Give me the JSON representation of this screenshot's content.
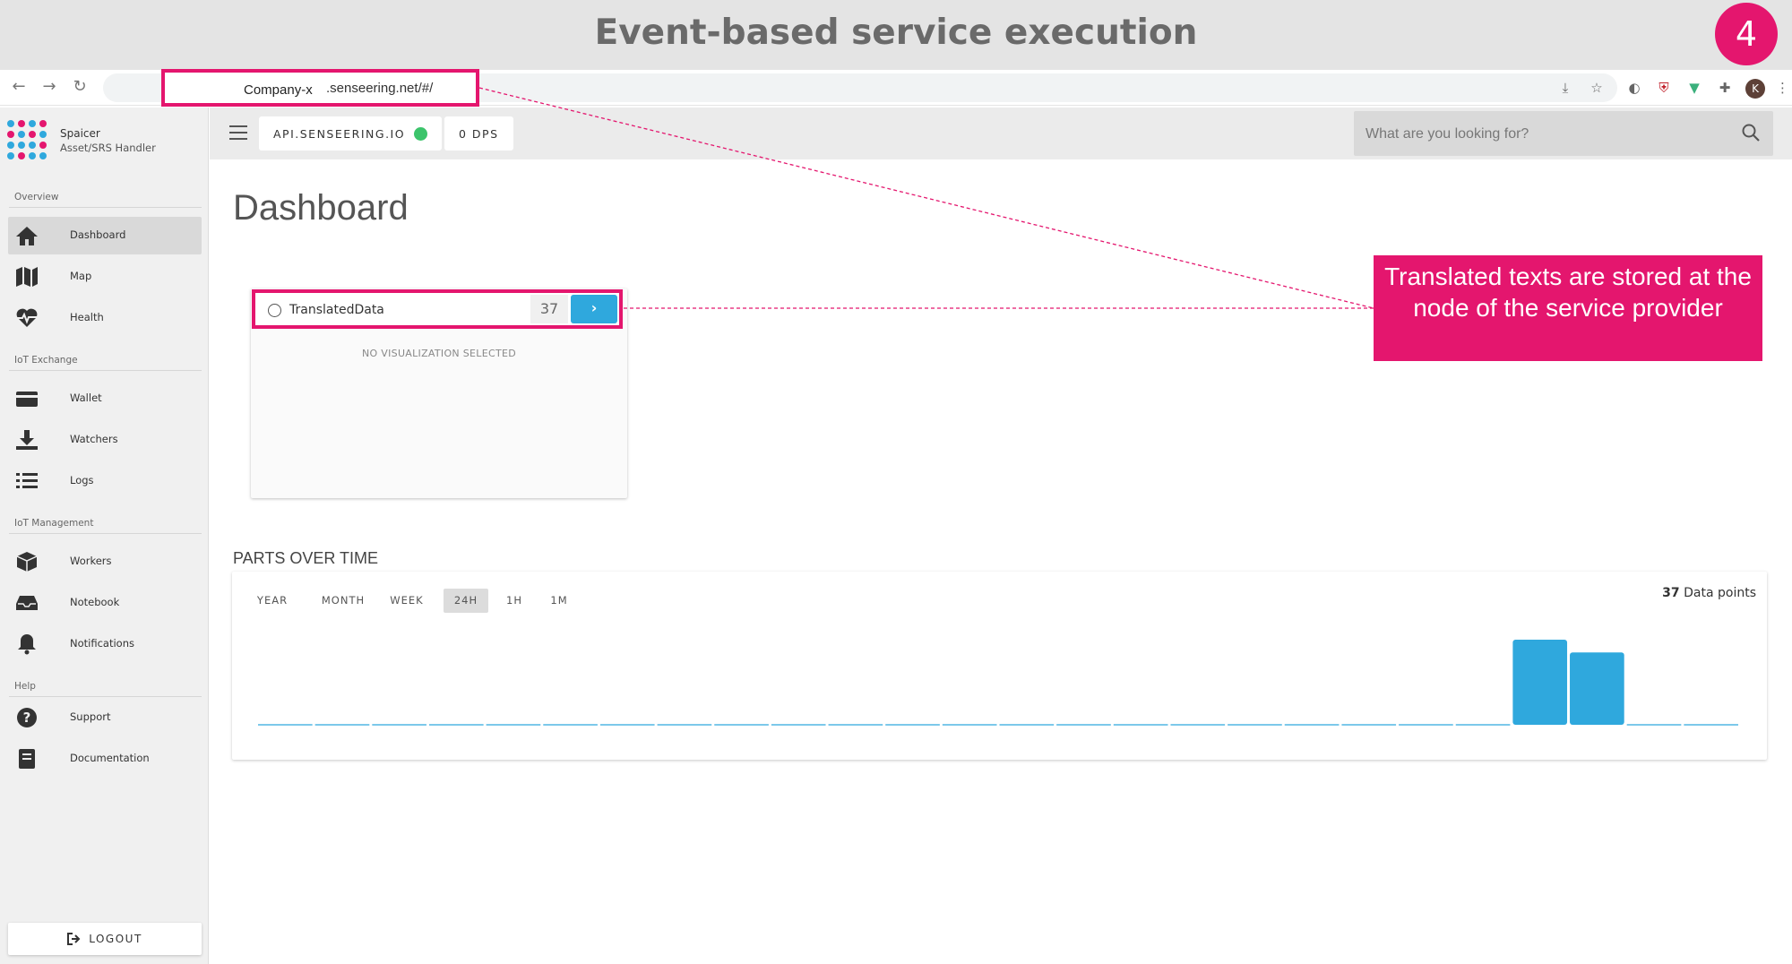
{
  "slide": {
    "title": "Event-based service execution",
    "step": "4"
  },
  "browser": {
    "url_company": "Company-x",
    "url_domain": ".senseering.net/#/",
    "profile_initial": "K"
  },
  "sidebar": {
    "brand_name": "Spaicer",
    "brand_role": "Asset/SRS Handler",
    "sections": {
      "overview": "Overview",
      "iot_exchange": "IoT Exchange",
      "iot_management": "IoT Management",
      "help": "Help"
    },
    "items": [
      {
        "label": "Dashboard",
        "icon": "home-icon"
      },
      {
        "label": "Map",
        "icon": "map-icon"
      },
      {
        "label": "Health",
        "icon": "heart-pulse-icon"
      },
      {
        "label": "Wallet",
        "icon": "wallet-icon"
      },
      {
        "label": "Watchers",
        "icon": "download-icon"
      },
      {
        "label": "Logs",
        "icon": "list-icon"
      },
      {
        "label": "Workers",
        "icon": "cube-icon"
      },
      {
        "label": "Notebook",
        "icon": "inbox-icon"
      },
      {
        "label": "Notifications",
        "icon": "bell-icon"
      },
      {
        "label": "Support",
        "icon": "help-circle-icon"
      },
      {
        "label": "Documentation",
        "icon": "book-icon"
      }
    ],
    "logout": "LOGOUT"
  },
  "topbar": {
    "api_chip": "API.SENSEERING.IO",
    "dps_chip": "0 DPS",
    "search_placeholder": "What are you looking for?"
  },
  "main": {
    "title": "Dashboard",
    "widget": {
      "name": "TranslatedData",
      "count": "37",
      "empty_text": "NO VISUALIZATION SELECTED"
    },
    "callout": "Translated texts are stored at the node of the service provider",
    "parts_title": "PARTS OVER TIME",
    "ranges": [
      "YEAR",
      "MONTH",
      "WEEK",
      "24H",
      "1H",
      "1M"
    ],
    "active_range": "24H",
    "data_points_count": "37",
    "data_points_label": "Data points"
  },
  "colors": {
    "accent": "#e4166e",
    "primary": "#2fa8dd",
    "status_ok": "#3cc46b"
  },
  "chart_data": {
    "type": "bar",
    "values": [
      0,
      0,
      0,
      0,
      0,
      0,
      0,
      0,
      0,
      0,
      0,
      0,
      0,
      0,
      0,
      0,
      0,
      0,
      0,
      0,
      0,
      0,
      20,
      17,
      0,
      0
    ]
  }
}
